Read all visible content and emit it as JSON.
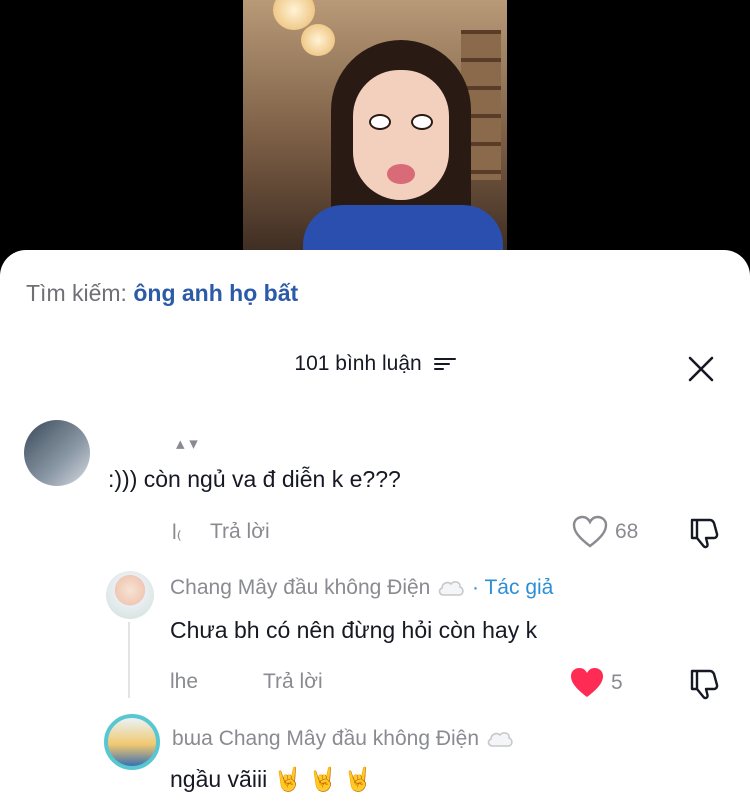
{
  "search": {
    "prefix": "Tìm kiếm:",
    "query": "ông anh họ bất"
  },
  "comments_header": {
    "count_label": "101 bình luận"
  },
  "comment_1": {
    "text": ":))) còn ngủ va đ diễn k e???",
    "reply_label": "Trả lời",
    "like_count": "68"
  },
  "reply_1": {
    "author": "Chang Mây đầu không Điện",
    "author_tag": "· Tác giả",
    "text": "Chưa bh có nên đừng hỏi còn hay k",
    "reply_label": "Trả lời",
    "like_count": "5",
    "liked": true
  },
  "reply_2": {
    "author": "Chang Mây đầu không Điện",
    "text": "ngầu vãiii 🤘 🤘 🤘"
  },
  "colors": {
    "link": "#2b5aa8",
    "author_tag": "#2b8fd6",
    "like_active": "#fe2c55",
    "muted": "#8a8b91"
  },
  "icons": [
    "sort-icon",
    "close-icon",
    "heart-icon",
    "heart-filled-icon",
    "dislike-icon",
    "cloud-icon"
  ]
}
